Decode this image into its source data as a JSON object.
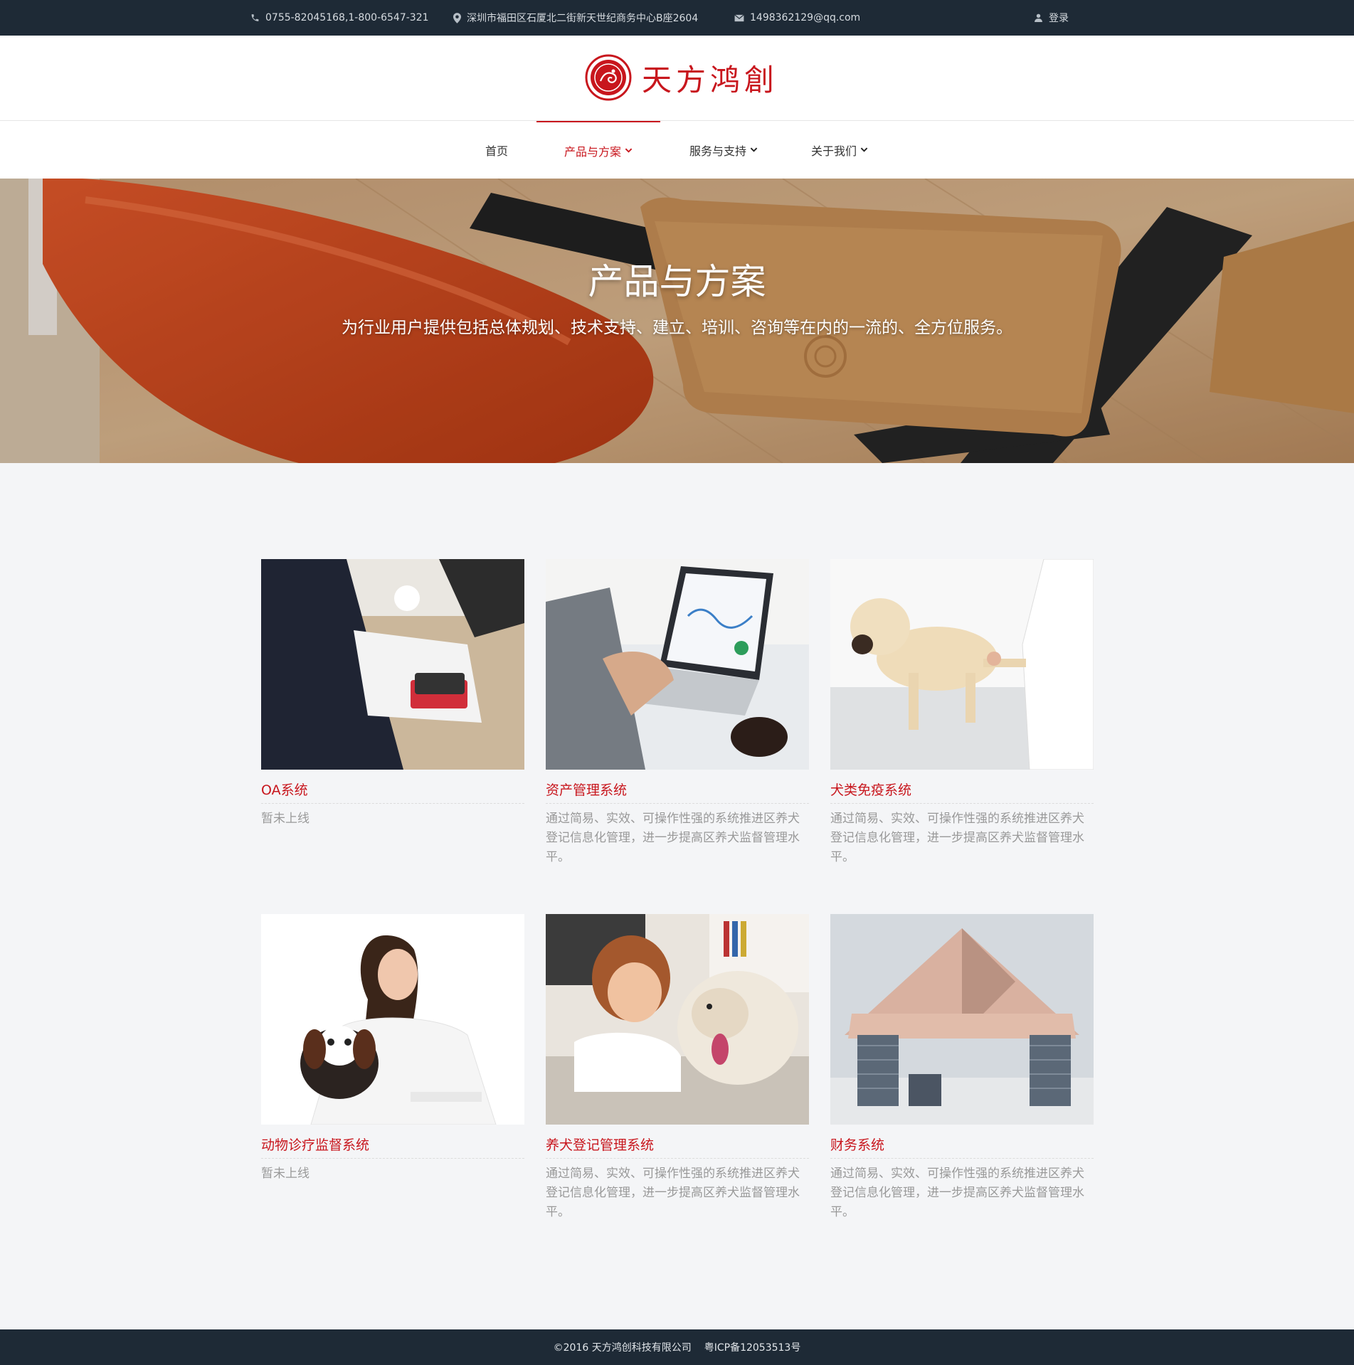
{
  "topbar": {
    "phone": "0755-82045168,1-800-6547-321",
    "address": "深圳市福田区石厦北二街新天世纪商务中心B座2604",
    "email": "1498362129@qq.com",
    "login": "登录"
  },
  "logo": {
    "brand": "天方鸿創"
  },
  "nav": {
    "items": [
      {
        "label": "首页",
        "has_dropdown": false,
        "active": false
      },
      {
        "label": "产品与方案",
        "has_dropdown": true,
        "active": true
      },
      {
        "label": "服务与支持",
        "has_dropdown": true,
        "active": false
      },
      {
        "label": "关于我们",
        "has_dropdown": true,
        "active": false
      }
    ]
  },
  "hero": {
    "title": "产品与方案",
    "subtitle": "为行业用户提供包括总体规划、技术支持、建立、培训、咨询等在内的一流的、全方位服务。"
  },
  "products": [
    {
      "title": "OA系统",
      "desc": "暂未上线",
      "image": "business-desk-photo"
    },
    {
      "title": "资产管理系统",
      "desc": "通过简易、实效、可操作性强的系统推进区养犬登记信息化管理，进一步提高区养犬监督管理水平。",
      "image": "laptop-analytics-photo"
    },
    {
      "title": "犬类免疫系统",
      "desc": "通过简易、实效、可操作性强的系统推进区养犬登记信息化管理，进一步提高区养犬监督管理水平。",
      "image": "vet-dog-photo"
    },
    {
      "title": "动物诊疗监督系统",
      "desc": "暂未上线",
      "image": "vet-woman-puppy-photo"
    },
    {
      "title": "养犬登记管理系统",
      "desc": "通过简易、实效、可操作性强的系统推进区养犬登记信息化管理，进一步提高区养犬监督管理水平。",
      "image": "woman-husky-photo"
    },
    {
      "title": "财务系统",
      "desc": "通过简易、实效、可操作性强的系统推进区养犬登记信息化管理，进一步提高区养犬监督管理水平。",
      "image": "money-house-photo"
    }
  ],
  "footer": {
    "copyright": "©2016 天方鸿创科技有限公司",
    "icp": "粤ICP备12053513号"
  },
  "colors": {
    "accent": "#c8161d",
    "dark": "#1e2a36",
    "page_bg": "#f4f5f7"
  }
}
